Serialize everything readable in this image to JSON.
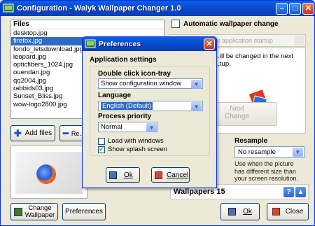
{
  "window": {
    "title": "Configuration - Walyk Wallpaper Changer 1.0",
    "minimize": "–",
    "maximize": "□",
    "close": "✕"
  },
  "files": {
    "header": "Files",
    "items": [
      "desktop.jpg",
      "firefox.jpg",
      "fondo_letsdownload.jpg",
      "leopard.jpg",
      "opticfibers_1024.jpg",
      "ouendan.jpg",
      "qq2004.jpg",
      "rabbids03.jpg",
      "Sunset_Bliss.jpg",
      "wow-logo2800.jpg"
    ],
    "selected_index": 1,
    "add_label": "Add files",
    "remove_label": "Re... f..."
  },
  "auto_change": {
    "label": "Automatic wallpaper change",
    "checked": false,
    "combo_value": "At application startup",
    "info_text": "...ill be changed in the next ...tup.",
    "next_label_1": "Next",
    "next_label_2": "Change"
  },
  "resample": {
    "title": "Resample",
    "value": "No resample",
    "help": "Use when the picture has different size than your screen resolution."
  },
  "wallpapers": {
    "label": "Wallpapers 15",
    "help_icon": "?",
    "up_icon": "▲"
  },
  "bottom": {
    "change_wallpaper_1": "Change",
    "change_wallpaper_2": "Wallpaper",
    "preferences": "Preferences",
    "ok": "Ok",
    "close": "Close"
  },
  "dialog": {
    "title": "Preferences",
    "close": "✕",
    "section": "Application settings",
    "double_click_label": "Double click icon-tray",
    "double_click_value": "Show configuration window",
    "language_label": "Language",
    "language_value": "English (Default)",
    "priority_label": "Process priority",
    "priority_value": "Normal",
    "load_with_windows": "Load with windows",
    "load_with_windows_checked": false,
    "splash_screen": "Show splash screen",
    "splash_screen_checked": true,
    "ok": "Ok",
    "cancel": "Cancel"
  },
  "colors": {
    "selection": "#316AC5",
    "titlebar": "#0846C6",
    "close_button": "#C33F1B",
    "face": "#ECE9D8"
  }
}
